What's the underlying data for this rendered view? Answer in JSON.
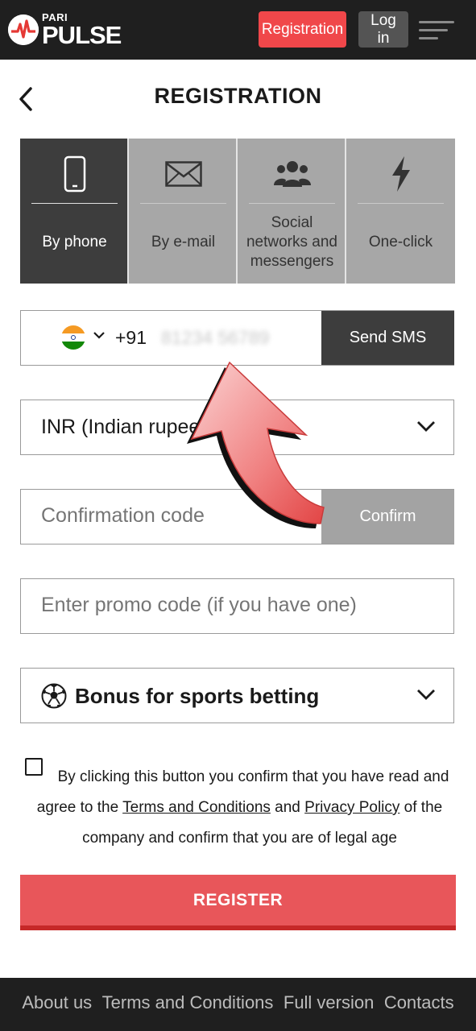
{
  "header": {
    "logo_small": "PARI",
    "logo_big": "PULSE",
    "registration_label": "Registration",
    "login_label": "Log in"
  },
  "page": {
    "title": "REGISTRATION"
  },
  "tabs": [
    {
      "label": "By phone",
      "icon": "phone-icon",
      "active": true
    },
    {
      "label": "By e-mail",
      "icon": "envelope-icon",
      "active": false
    },
    {
      "label": "Social networks and messengers",
      "icon": "users-icon",
      "active": false
    },
    {
      "label": "One-click",
      "icon": "lightning-icon",
      "active": false
    }
  ],
  "phone": {
    "dial_code": "+91",
    "number": "81234 56789",
    "send_sms_label": "Send SMS"
  },
  "currency": {
    "selected": "INR (Indian rupee)"
  },
  "confirmation": {
    "placeholder": "Confirmation code",
    "confirm_label": "Confirm"
  },
  "promo": {
    "placeholder": "Enter promo code (if you have one)"
  },
  "bonus": {
    "selected": "Bonus for sports betting"
  },
  "agreement": {
    "text_1": "By clicking this button you confirm that you have read and agree to the ",
    "terms_link": "Terms and Conditions",
    "text_2": " and ",
    "privacy_link": "Privacy Policy",
    "text_3": " of the company and confirm that you are of legal age"
  },
  "register_label": "REGISTER",
  "footer": {
    "links": [
      "About us",
      "Terms and Conditions",
      "Full version",
      "Contacts"
    ]
  },
  "colors": {
    "header_bg": "#1f1f1f",
    "accent_red": "#f0474a",
    "register_red": "#e8565a",
    "tab_active": "#3d3d3d",
    "tab_inactive": "#a7a7a7"
  }
}
